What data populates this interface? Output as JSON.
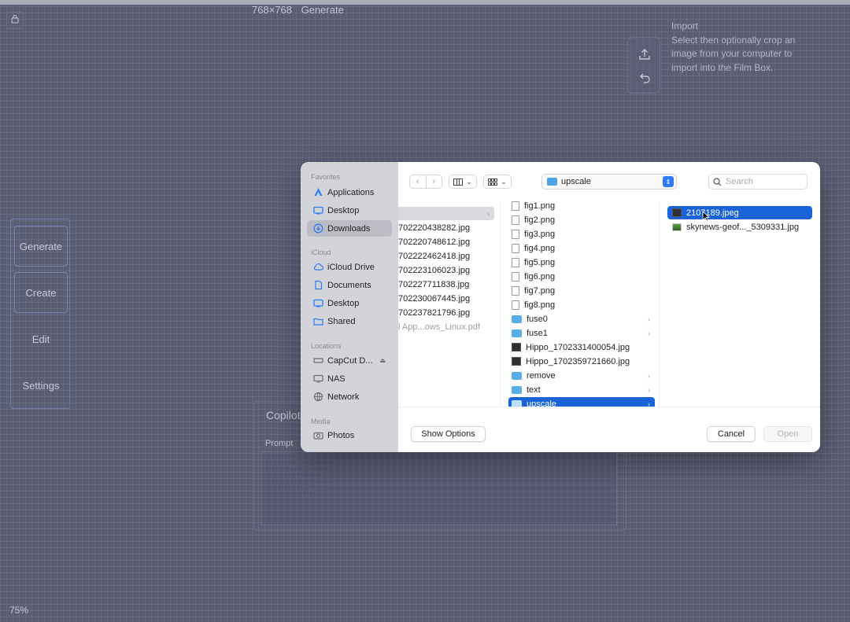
{
  "canvas": {
    "dimensions": "768×768",
    "generate_label": "Generate",
    "zoom": "75%"
  },
  "import": {
    "title": "Import",
    "description": "Select then optionally crop an image from your computer to import into the Film Box."
  },
  "sidebar": {
    "items": [
      {
        "label": "Generate"
      },
      {
        "label": "Create"
      },
      {
        "label": "Edit"
      },
      {
        "label": "Settings"
      }
    ]
  },
  "copilot": {
    "title": "Copilot",
    "prompt_label": "Prompt"
  },
  "dialog": {
    "sections": {
      "favorites": "Favorites",
      "icloud": "iCloud",
      "locations": "Locations",
      "media": "Media"
    },
    "favorites": [
      {
        "label": "Applications",
        "icon": "applications-icon"
      },
      {
        "label": "Desktop",
        "icon": "desktop-icon"
      },
      {
        "label": "Downloads",
        "icon": "downloads-icon"
      }
    ],
    "icloud": [
      {
        "label": "iCloud Drive",
        "icon": "cloud-icon"
      },
      {
        "label": "Documents",
        "icon": "document-icon"
      },
      {
        "label": "Desktop",
        "icon": "desktop-icon"
      },
      {
        "label": "Shared",
        "icon": "shared-folder-icon"
      }
    ],
    "locations": [
      {
        "label": "CapCut D...",
        "icon": "drive-icon"
      },
      {
        "label": "NAS",
        "icon": "monitor-icon"
      },
      {
        "label": "Network",
        "icon": "network-icon"
      }
    ],
    "media": [
      {
        "label": "Photos",
        "icon": "camera-icon"
      }
    ],
    "path": "upscale",
    "search_placeholder": "Search",
    "col1": [
      "702220438282.jpg",
      "702220748612.jpg",
      "702222462418.jpg",
      "702223106023.jpg",
      "702227711838.jpg",
      "702230067445.jpg",
      "702237821796.jpg",
      "l App...ows_Linux.pdf"
    ],
    "col2": [
      {
        "name": "fig1.png",
        "kind": "doc"
      },
      {
        "name": "fig2.png",
        "kind": "doc"
      },
      {
        "name": "fig3.png",
        "kind": "doc"
      },
      {
        "name": "fig4.png",
        "kind": "doc"
      },
      {
        "name": "fig5.png",
        "kind": "doc"
      },
      {
        "name": "fig6.png",
        "kind": "doc"
      },
      {
        "name": "fig7.png",
        "kind": "doc"
      },
      {
        "name": "fig8.png",
        "kind": "doc"
      },
      {
        "name": "fuse0",
        "kind": "folder"
      },
      {
        "name": "fuse1",
        "kind": "folder"
      },
      {
        "name": "Hippo_1702331400054.jpg",
        "kind": "img"
      },
      {
        "name": "Hippo_1702359721660.jpg",
        "kind": "img"
      },
      {
        "name": "remove",
        "kind": "folder"
      },
      {
        "name": "text",
        "kind": "folder"
      },
      {
        "name": "upscale",
        "kind": "folder"
      }
    ],
    "col3": [
      {
        "name": "2107189.jpeg",
        "kind": "img"
      },
      {
        "name": "skynews-geof..._5309331.jpg",
        "kind": "jpg2"
      }
    ],
    "buttons": {
      "show_options": "Show Options",
      "cancel": "Cancel",
      "open": "Open"
    }
  }
}
